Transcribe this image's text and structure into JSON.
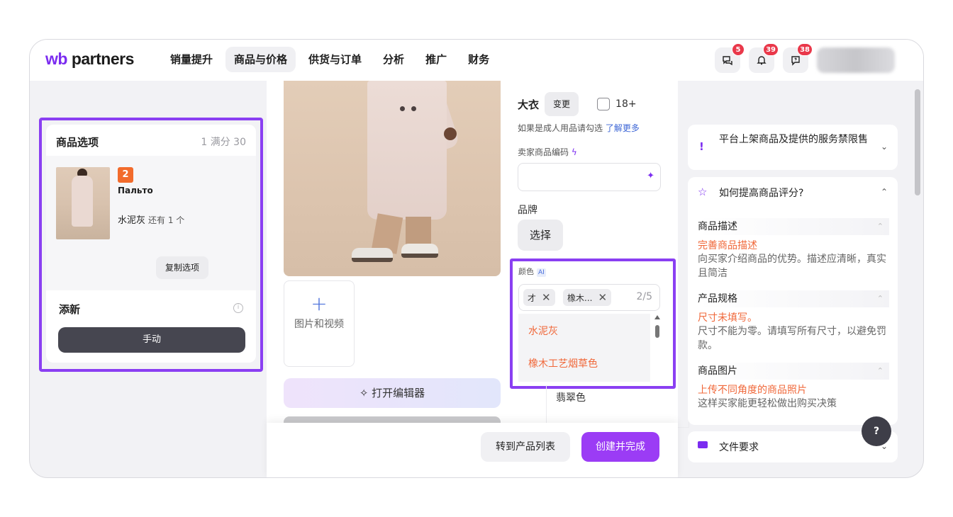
{
  "header": {
    "logo_wb": "wb",
    "logo_rest": " partners",
    "nav": [
      "销量提升",
      "商品与价格",
      "供货与订单",
      "分析",
      "推广",
      "财务"
    ],
    "active_nav": "商品与价格",
    "badges": {
      "chat": "5",
      "bell": "39",
      "help": "38"
    }
  },
  "left": {
    "title": "商品选项",
    "score": "1 满分 30",
    "variant": {
      "number": "2",
      "name": "Пальто",
      "color": "水泥灰",
      "remaining": "还有 1 个",
      "copy_label": "复制选项"
    },
    "add_label": "添新",
    "info_glyph": "i",
    "manual_label": "手动"
  },
  "center": {
    "add_media_label": "图片和视频",
    "editor_label": "打开编辑器",
    "editor_icon": "✧"
  },
  "form": {
    "category": "大衣",
    "change_label": "变更",
    "age_label": "18+",
    "hint_text": "如果是成人用品请勾选 ",
    "hint_link": "了解更多",
    "seller_code_label": "卖家商品编码",
    "brand_label": "品牌",
    "brand_button": "选择",
    "color_label": "颜色",
    "color_ai_badge": "AI",
    "tags": [
      {
        "label": "才"
      },
      {
        "label": "橡木..."
      }
    ],
    "tag_count": "2/5",
    "options": [
      "水泥灰",
      "橡木工艺烟草色"
    ],
    "next_option": "翡翠色"
  },
  "footer": {
    "list_button": "转到产品列表",
    "create_button": "创建并完成"
  },
  "right": {
    "banned_text": "平台上架商品及提供的服务禁限售",
    "rating_title": "如何提高商品评分?",
    "sections": [
      {
        "title": "商品描述",
        "action": "完善商品描述",
        "desc": "向买家介绍商品的优势。描述应清晰，真实且简洁"
      },
      {
        "title": "产品规格",
        "action": "尺寸未填写。",
        "desc": "尺寸不能为零。请填写所有尺寸，以避免罚款。"
      },
      {
        "title": "商品图片",
        "action": "上传不同角度的商品照片",
        "desc": "这样买家能更轻松做出购买决策"
      }
    ],
    "file_req": "文件要求",
    "help_label": "?"
  },
  "colors": {
    "accent": "#8a3ff2",
    "primary_button": "#9b3cf5",
    "orange_text": "#f0683a",
    "dark_button": "#464650"
  }
}
